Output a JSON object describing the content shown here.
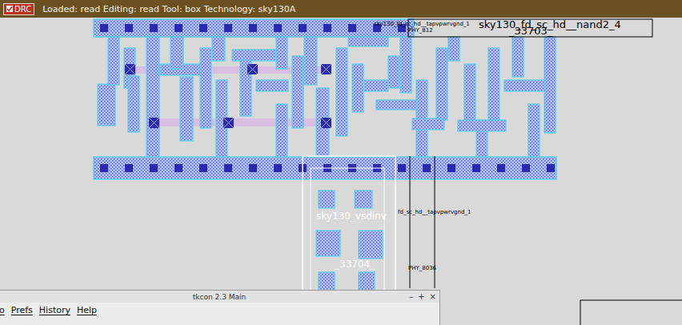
{
  "status_bar": {
    "drc": {
      "label": "DRC",
      "checked": true
    },
    "message": "Loaded: read Editing: read Tool: box  Technology: sky130A"
  },
  "layout": {
    "labels": [
      {
        "text": "sky130_fd_sc_hd__tapvpwrvgnd_1",
        "kind": "tiny"
      },
      {
        "text": "PHY_812",
        "kind": "tiny"
      },
      {
        "text": "sky130_fd_sc_hd__nand2_4",
        "kind": "large"
      },
      {
        "text": "_33703_",
        "kind": "large"
      },
      {
        "text": "sky130_vsdinv",
        "kind": "cell"
      },
      {
        "text": "_33704_",
        "kind": "cell"
      },
      {
        "text": "fd_sc_hd__tapvpwrvgnd_1",
        "kind": "tiny"
      },
      {
        "text": "PHY_8036",
        "kind": "tiny"
      }
    ]
  },
  "console": {
    "title": "tkcon 2.3 Main",
    "controls": [
      "–",
      "+",
      "×"
    ],
    "menu": [
      "o",
      "Prefs",
      "History",
      "Help"
    ]
  }
}
